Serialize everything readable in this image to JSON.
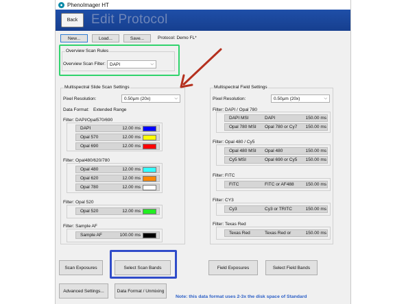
{
  "window": {
    "title": "PhenoImager HT"
  },
  "header": {
    "back_label": "Back",
    "title": "Edit Protocol"
  },
  "toolbar": {
    "new_label": "New...",
    "load_label": "Load...",
    "save_label": "Save...",
    "protocol_text": "Protocol: Demo FL*"
  },
  "overview": {
    "group_title": "Overview Scan Rules",
    "filter_label": "Overview Scan Filter:",
    "filter_value": "DAPI"
  },
  "slide": {
    "group_title": "Multispectral Slide Scan Settings",
    "pixel_label": "Pixel Resolution:",
    "pixel_value": "0.50µm (20x)",
    "format_label": "Data Format:",
    "format_value": "Extended Range",
    "filters": [
      {
        "title": "Filter: DAPI/Opal570/690",
        "rows": [
          {
            "name": "DAPI",
            "value": "12.00 ms",
            "color": "#0000ff"
          },
          {
            "name": "Opal 570",
            "value": "12.00 ms",
            "color": "#ffff00"
          },
          {
            "name": "Opal 690",
            "value": "12.00 ms",
            "color": "#ff0000"
          }
        ]
      },
      {
        "title": "Filter: Opal480/620/780",
        "rows": [
          {
            "name": "Opal 480",
            "value": "12.00 ms",
            "color": "#33ffff"
          },
          {
            "name": "Opal 620",
            "value": "12.00 ms",
            "color": "#ff8800"
          },
          {
            "name": "Opal 780",
            "value": "12.00 ms",
            "color": "#ffffff"
          }
        ]
      },
      {
        "title": "Filter: Opal 520",
        "rows": [
          {
            "name": "Opal 520",
            "value": "12.00 ms",
            "color": "#22ee22"
          }
        ]
      },
      {
        "title": "Filter: Sample AF",
        "rows": [
          {
            "name": "Sample AF",
            "value": "100.00 ms",
            "color": "#000000"
          }
        ]
      }
    ]
  },
  "field": {
    "group_title": "Multispectral Field Settings",
    "pixel_label": "Pixel Resolution:",
    "pixel_value": "0.50µm (20x)",
    "filters": [
      {
        "title": "Filter: DAPI / Opal 780",
        "rows": [
          {
            "name": "DAPI MSI",
            "col2": "DAPI",
            "value": "150.00 ms"
          },
          {
            "name": "Opal 780 MSI",
            "col2": "Opal 780 or Cy7",
            "value": "150.00 ms"
          }
        ]
      },
      {
        "title": "Filter: Opal 480 / Cy5",
        "rows": [
          {
            "name": "Opal 480 MSI",
            "col2": "Opal 480",
            "value": "150.00 ms"
          },
          {
            "name": "Cy5 MSI",
            "col2": "Opal 690 or Cy5",
            "value": "150.00 ms"
          }
        ]
      },
      {
        "title": "Filter: FITC",
        "rows": [
          {
            "name": "FITC",
            "col2": "FITC or AF488",
            "value": "150.00 ms"
          }
        ]
      },
      {
        "title": "Filter: CY3",
        "rows": [
          {
            "name": "Cy3",
            "col2": "Cy3 or TRITC",
            "value": "150.00 ms"
          }
        ]
      },
      {
        "title": "Filter: Texas Red",
        "rows": [
          {
            "name": "Texas Red",
            "col2": "Texas Red or",
            "value": "150.00 ms"
          }
        ]
      }
    ]
  },
  "buttons": {
    "scan_exposures": "Scan Exposures",
    "select_scan_bands": "Select Scan Bands",
    "field_exposures": "Field Exposures",
    "select_field_bands": "Select Field Bands",
    "advanced_settings": "Advanced Settings...",
    "data_format": "Data Format / Unmixing"
  },
  "note": "Note: this data format uses 2-3x the disk space of Standard",
  "colors": {
    "header_blue": "#1f4fa8",
    "green_highlight": "#2fd36c",
    "blue_highlight": "#2f4bc9",
    "arrow_red": "#b5301e"
  },
  "icons": {
    "app": "phenoimager-app-icon",
    "dropdown": "chevron-down-icon",
    "annotation": "red-arrow-annotation"
  }
}
